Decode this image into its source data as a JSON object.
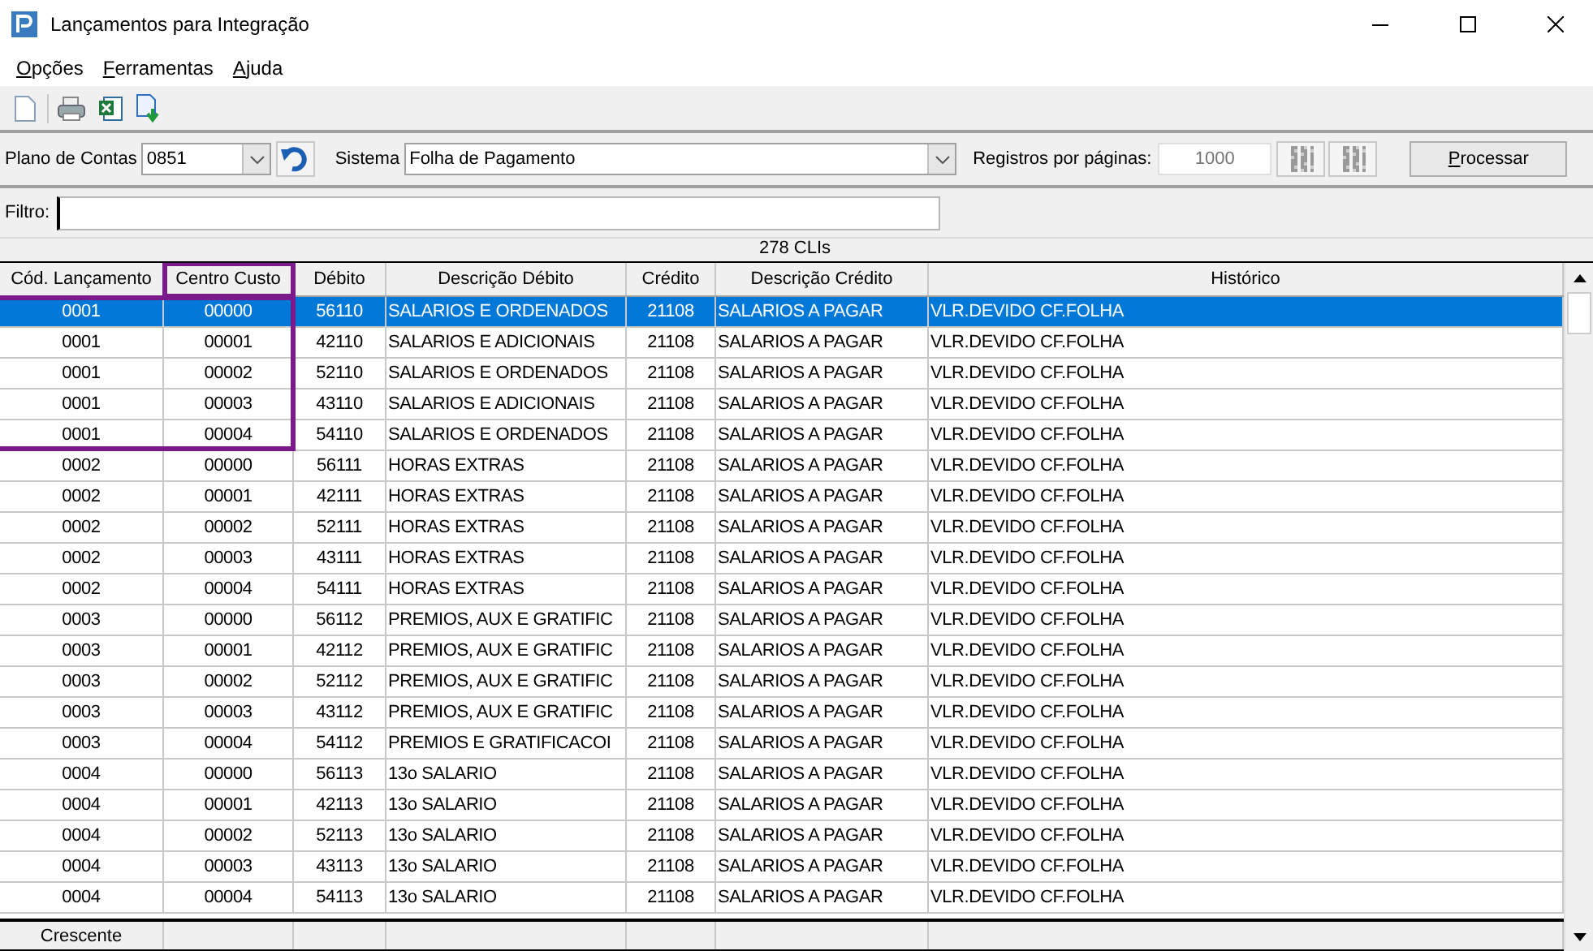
{
  "window": {
    "title": "Lançamentos para Integração"
  },
  "menu": [
    "Opções",
    "Ferramentas",
    "Ajuda"
  ],
  "params": {
    "plano_label": "Plano de Contas",
    "plano_value": "0851",
    "sistema_label": "Sistema",
    "sistema_value": "Folha de Pagamento",
    "registros_label": "Registros por páginas:",
    "registros_value": "1000",
    "process_button": "Processar"
  },
  "filter": {
    "label": "Filtro:"
  },
  "count": "278 CLIs",
  "table": {
    "columns": [
      {
        "label": "Cód. Lançamento",
        "highlighted": false
      },
      {
        "label": "Centro Custo",
        "highlighted": true
      },
      {
        "label": "Débito",
        "highlighted": false
      },
      {
        "label": "Descrição Débito",
        "highlighted": false
      },
      {
        "label": "Crédito",
        "highlighted": false
      },
      {
        "label": "Descrição Crédito",
        "highlighted": false
      },
      {
        "label": "Histórico",
        "highlighted": false
      }
    ],
    "rows": [
      {
        "cells": [
          "0001",
          "00000",
          "56110",
          "SALARIOS E ORDENADOS",
          "21108",
          "SALARIOS A PAGAR",
          "VLR.DEVIDO CF.FOLHA"
        ],
        "selected": true,
        "highlighted": true
      },
      {
        "cells": [
          "0001",
          "00001",
          "42110",
          "SALARIOS E ADICIONAIS",
          "21108",
          "SALARIOS A PAGAR",
          "VLR.DEVIDO CF.FOLHA"
        ],
        "selected": false,
        "highlighted": true
      },
      {
        "cells": [
          "0001",
          "00002",
          "52110",
          "SALARIOS E ORDENADOS",
          "21108",
          "SALARIOS A PAGAR",
          "VLR.DEVIDO CF.FOLHA"
        ],
        "selected": false,
        "highlighted": true
      },
      {
        "cells": [
          "0001",
          "00003",
          "43110",
          "SALARIOS E ADICIONAIS",
          "21108",
          "SALARIOS A PAGAR",
          "VLR.DEVIDO CF.FOLHA"
        ],
        "selected": false,
        "highlighted": true
      },
      {
        "cells": [
          "0001",
          "00004",
          "54110",
          "SALARIOS E ORDENADOS",
          "21108",
          "SALARIOS A PAGAR",
          "VLR.DEVIDO CF.FOLHA"
        ],
        "selected": false,
        "highlighted": true
      },
      {
        "cells": [
          "0002",
          "00000",
          "56111",
          "HORAS EXTRAS",
          "21108",
          "SALARIOS A PAGAR",
          "VLR.DEVIDO CF.FOLHA"
        ],
        "selected": false,
        "highlighted": false
      },
      {
        "cells": [
          "0002",
          "00001",
          "42111",
          "HORAS EXTRAS",
          "21108",
          "SALARIOS A PAGAR",
          "VLR.DEVIDO CF.FOLHA"
        ],
        "selected": false,
        "highlighted": false
      },
      {
        "cells": [
          "0002",
          "00002",
          "52111",
          "HORAS EXTRAS",
          "21108",
          "SALARIOS A PAGAR",
          "VLR.DEVIDO CF.FOLHA"
        ],
        "selected": false,
        "highlighted": false
      },
      {
        "cells": [
          "0002",
          "00003",
          "43111",
          "HORAS EXTRAS",
          "21108",
          "SALARIOS A PAGAR",
          "VLR.DEVIDO CF.FOLHA"
        ],
        "selected": false,
        "highlighted": false
      },
      {
        "cells": [
          "0002",
          "00004",
          "54111",
          "HORAS EXTRAS",
          "21108",
          "SALARIOS A PAGAR",
          "VLR.DEVIDO CF.FOLHA"
        ],
        "selected": false,
        "highlighted": false
      },
      {
        "cells": [
          "0003",
          "00000",
          "56112",
          "PREMIOS, AUX E GRATIFIC",
          "21108",
          "SALARIOS A PAGAR",
          "VLR.DEVIDO CF.FOLHA"
        ],
        "selected": false,
        "highlighted": false
      },
      {
        "cells": [
          "0003",
          "00001",
          "42112",
          "PREMIOS, AUX E GRATIFIC",
          "21108",
          "SALARIOS A PAGAR",
          "VLR.DEVIDO CF.FOLHA"
        ],
        "selected": false,
        "highlighted": false
      },
      {
        "cells": [
          "0003",
          "00002",
          "52112",
          "PREMIOS, AUX E GRATIFIC",
          "21108",
          "SALARIOS A PAGAR",
          "VLR.DEVIDO CF.FOLHA"
        ],
        "selected": false,
        "highlighted": false
      },
      {
        "cells": [
          "0003",
          "00003",
          "43112",
          "PREMIOS, AUX E GRATIFIC",
          "21108",
          "SALARIOS A PAGAR",
          "VLR.DEVIDO CF.FOLHA"
        ],
        "selected": false,
        "highlighted": false
      },
      {
        "cells": [
          "0003",
          "00004",
          "54112",
          "PREMIOS E GRATIFICACOI",
          "21108",
          "SALARIOS A PAGAR",
          "VLR.DEVIDO CF.FOLHA"
        ],
        "selected": false,
        "highlighted": false
      },
      {
        "cells": [
          "0004",
          "00000",
          "56113",
          "13o SALARIO",
          "21108",
          "SALARIOS A PAGAR",
          "VLR.DEVIDO CF.FOLHA"
        ],
        "selected": false,
        "highlighted": false
      },
      {
        "cells": [
          "0004",
          "00001",
          "42113",
          "13o SALARIO",
          "21108",
          "SALARIOS A PAGAR",
          "VLR.DEVIDO CF.FOLHA"
        ],
        "selected": false,
        "highlighted": false
      },
      {
        "cells": [
          "0004",
          "00002",
          "52113",
          "13o SALARIO",
          "21108",
          "SALARIOS A PAGAR",
          "VLR.DEVIDO CF.FOLHA"
        ],
        "selected": false,
        "highlighted": false
      },
      {
        "cells": [
          "0004",
          "00003",
          "43113",
          "13o SALARIO",
          "21108",
          "SALARIOS A PAGAR",
          "VLR.DEVIDO CF.FOLHA"
        ],
        "selected": false,
        "highlighted": false
      },
      {
        "cells": [
          "0004",
          "00004",
          "54113",
          "13o SALARIO",
          "21108",
          "SALARIOS A PAGAR",
          "VLR.DEVIDO CF.FOLHA"
        ],
        "selected": false,
        "highlighted": false
      }
    ],
    "footer": "Crescente"
  }
}
